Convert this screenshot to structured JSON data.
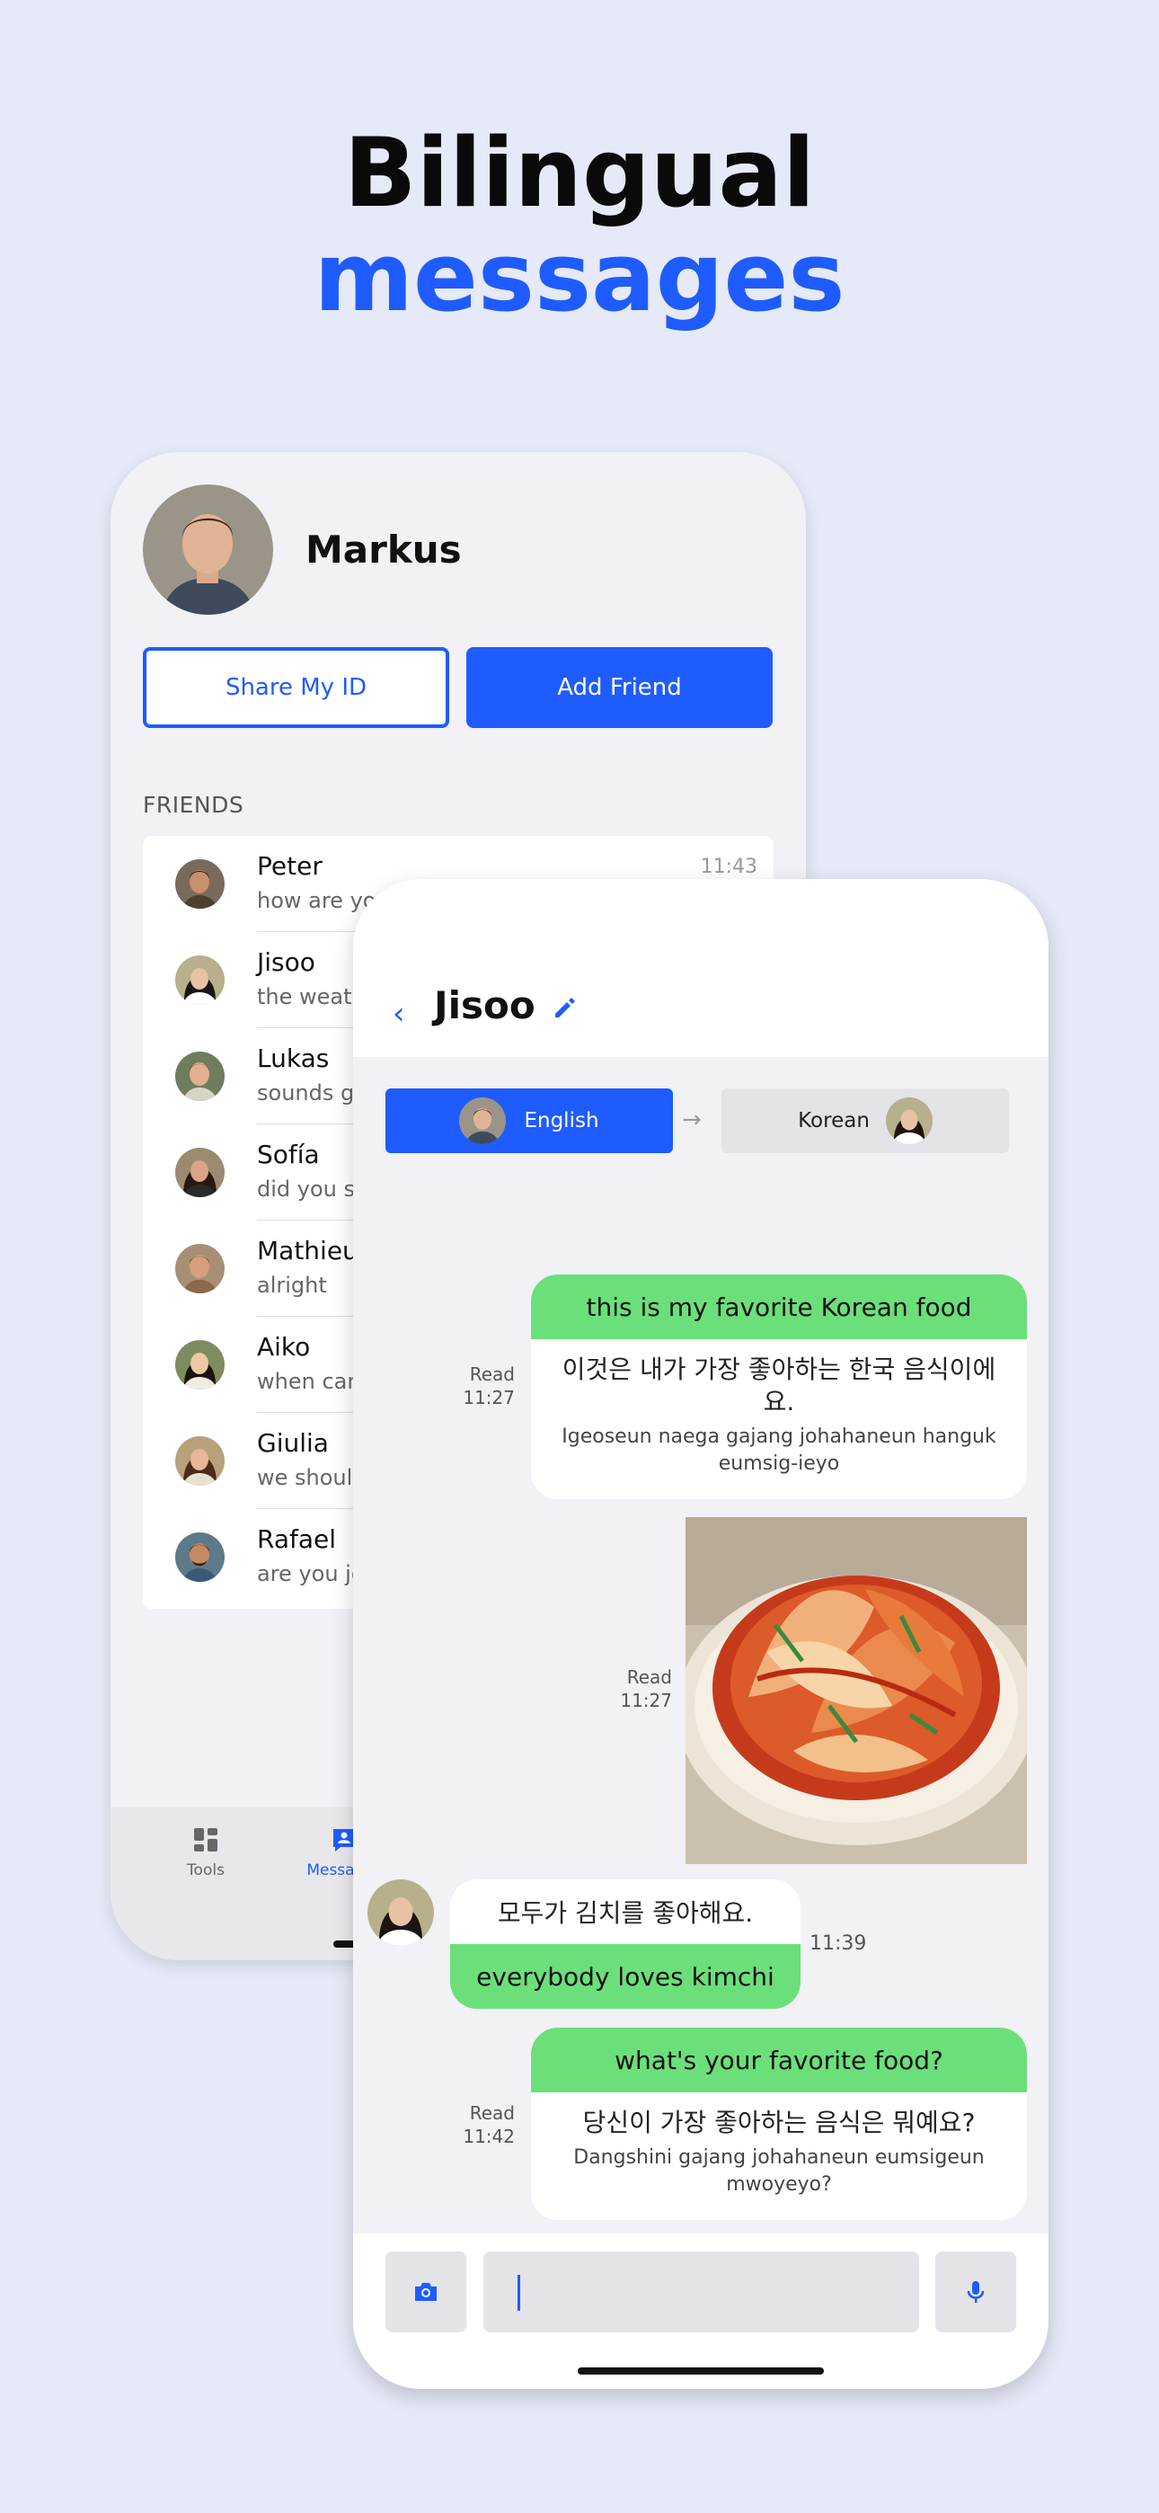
{
  "headline": {
    "line1": "Bilingual",
    "line2": "messages"
  },
  "profile": {
    "name": "Markus"
  },
  "buttons": {
    "share_id": "Share My ID",
    "add_friend": "Add Friend"
  },
  "friends_label": "FRIENDS",
  "friends": [
    {
      "name": "Peter",
      "preview": "how are you",
      "time": "11:43"
    },
    {
      "name": "Jisoo",
      "preview": "the weath",
      "time": ""
    },
    {
      "name": "Lukas",
      "preview": "sounds g",
      "time": ""
    },
    {
      "name": "Sofía",
      "preview": "did you s",
      "time": ""
    },
    {
      "name": "Mathieu",
      "preview": "alright",
      "time": ""
    },
    {
      "name": "Aiko",
      "preview": "when can",
      "time": ""
    },
    {
      "name": "Giulia",
      "preview": "we should",
      "time": ""
    },
    {
      "name": "Rafael",
      "preview": "are you jo",
      "time": ""
    }
  ],
  "tabbar": {
    "tools": "Tools",
    "messages": "Messages"
  },
  "chat": {
    "title": "Jisoo",
    "lang_source": "English",
    "lang_target": "Korean",
    "messages": [
      {
        "original": "this is my favorite Korean food",
        "translation": "이것은 내가 가장 좋아하는 한국 음식이에요.",
        "romanization": "Igeoseun naega gajang johahaneun hanguk eumsig-ieyo",
        "status": "Read",
        "time": "11:27"
      },
      {
        "status": "Read",
        "time": "11:27"
      },
      {
        "translation": "모두가 김치를 좋아해요.",
        "original": "everybody loves kimchi",
        "time": "11:39"
      },
      {
        "original": "what's your favorite food?",
        "translation": "당신이 가장 좋아하는 음식은 뭐예요?",
        "romanization": "Dangshini gajang johahaneun eumsigeun mwoyeyo?",
        "status": "Read",
        "time": "11:42"
      }
    ]
  },
  "composer": {
    "value": ""
  },
  "colors": {
    "accent": "#1f5cff",
    "original_bubble": "#6be07a",
    "background": "#e6e9f7"
  },
  "icons": [
    "chevron-left-icon",
    "pencil-icon",
    "arrow-right-icon",
    "camera-icon",
    "microphone-icon",
    "grid-icon",
    "contact-card-icon"
  ]
}
